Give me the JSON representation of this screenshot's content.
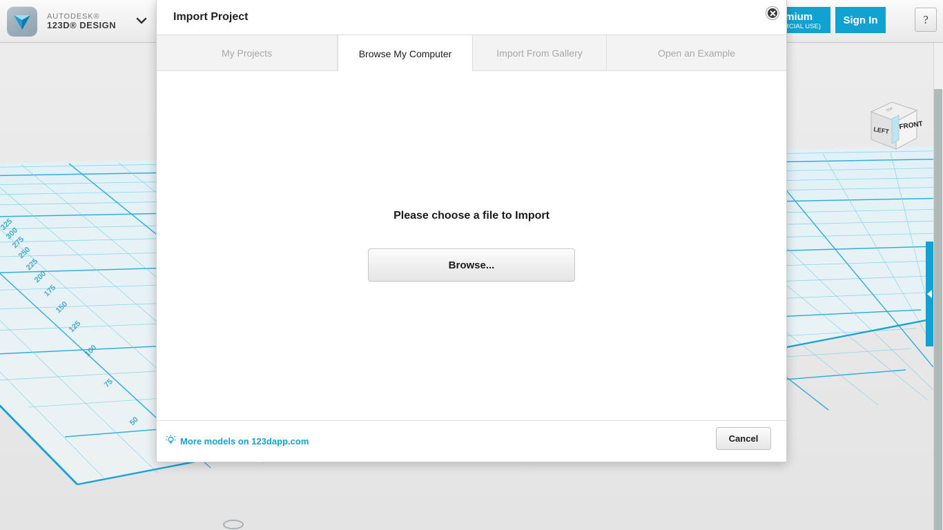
{
  "app": {
    "brand_sup": "AUTODESK®",
    "brand_main": "123D® DESIGN",
    "caret_icon": "chevron-down-icon",
    "logo_icon": "autodesk-123d-logo"
  },
  "topbar": {
    "premium_line1": "o Premium",
    "premium_line2": "COMMERCIAL USE)",
    "signin_label": "Sign In",
    "help_label": "?"
  },
  "viewcube": {
    "face_left": "LEFT",
    "face_front": "FRONT",
    "face_top": "TOP"
  },
  "panel": {
    "tab_icon": "triangle-left-icon"
  },
  "dialog": {
    "title": "Import Project",
    "close_icon": "close-icon",
    "tabs": [
      {
        "label": "My Projects",
        "active": false
      },
      {
        "label": "Browse My Computer",
        "active": true
      },
      {
        "label": "Import From Gallery",
        "active": false
      },
      {
        "label": "Open an Example",
        "active": false
      }
    ],
    "body": {
      "prompt": "Please choose a file to Import",
      "browse_label": "Browse..."
    },
    "footer": {
      "link_icon": "lightbulb-icon",
      "link_label": "More models on 123dapp.com",
      "cancel_label": "Cancel"
    }
  },
  "viewport": {
    "grid_labels_left": [
      "50",
      "75",
      "100",
      "125",
      "150",
      "175",
      "200",
      "225",
      "250",
      "275",
      "300",
      "325"
    ],
    "grid_color": "#29abdf",
    "grid_fill": "#e8f6fb",
    "background": "#eaeaea"
  },
  "colors": {
    "accent": "#11a2d2",
    "grid": "#29abdf",
    "text": "#1c1c1c",
    "muted": "#a8a8a8"
  }
}
